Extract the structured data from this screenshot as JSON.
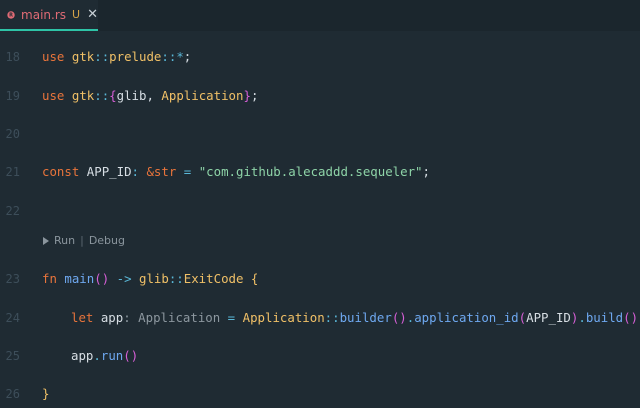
{
  "tab": {
    "filename": "main.rs",
    "status": "U",
    "close": "✕"
  },
  "line_numbers": [
    "18",
    "19",
    "20",
    "21",
    "22",
    "23",
    "24",
    "25",
    "26"
  ],
  "codelens": {
    "run": "Run",
    "separator": "|",
    "debug": "Debug"
  },
  "code": {
    "l18": {
      "kw": "use",
      "ns": "gtk",
      "sep": "::",
      "item": "prelude",
      "sep2": "::",
      "glob": "*",
      "semi": ";"
    },
    "l19": {
      "kw": "use",
      "ns": "gtk",
      "sep": "::",
      "open": "{",
      "a": "glib",
      "comma": ", ",
      "b": "Application",
      "close": "}",
      "semi": ";"
    },
    "l21": {
      "kw": "const",
      "name": " APP_ID",
      "colon": ": ",
      "amp": "&",
      "ty": "str",
      "eq": " = ",
      "str": "\"com.github.alecaddd.sequeler\"",
      "semi": ";"
    },
    "l23": {
      "kw": "fn",
      "fname": "main",
      "parens": "()",
      "arrow": " -> ",
      "ns": "glib",
      "sep": "::",
      "ty": "ExitCode",
      "brace": " {"
    },
    "l24": {
      "kw": "let",
      "var": " app",
      "colon": ": ",
      "hint": "Application",
      "eq": " = ",
      "ty": "Application",
      "sep": "::",
      "f1": "builder",
      "p1": "()",
      "dot1": ".",
      "f2": "application_id",
      "po": "(",
      "arg": "APP_ID",
      "pc": ")",
      "dot2": ".",
      "f3": "build",
      "p3": "()",
      "semi": ";"
    },
    "l25": {
      "var": "app",
      "dot": ".",
      "f": "run",
      "p": "()"
    },
    "l26": {
      "brace": "}"
    }
  }
}
